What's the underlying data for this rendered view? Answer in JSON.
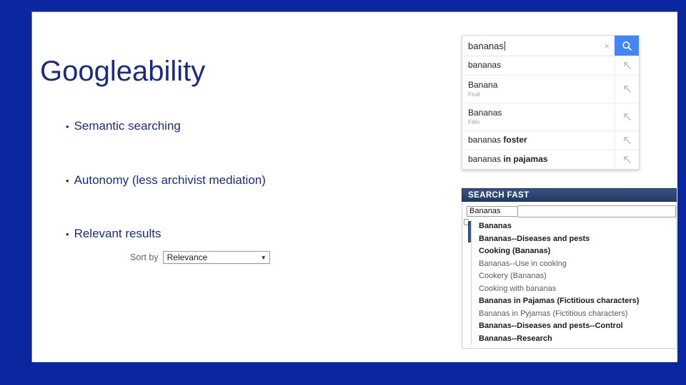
{
  "slide": {
    "title": "Googleability",
    "frame_color": "#0A27A0",
    "text_color": "#1B2C7E",
    "bullets": [
      {
        "marker": "•",
        "text": "Semantic searching"
      },
      {
        "marker": "•",
        "text": "Autonomy (less archivist mediation)"
      },
      {
        "marker": "•",
        "text": "Relevant results"
      }
    ]
  },
  "sort_control": {
    "label": "Sort by",
    "selected": "Relevance",
    "caret": "▼",
    "options": [
      "Relevance"
    ]
  },
  "google_autocomplete": {
    "query": "bananas",
    "clear_icon": "×",
    "search_icon": "search-icon",
    "accent_color": "#4285f4",
    "suggestions": [
      {
        "text": "bananas",
        "bold": "",
        "subtitle": ""
      },
      {
        "text": "Banana",
        "bold": "",
        "subtitle": "Fruit"
      },
      {
        "text": "Bananas",
        "bold": "",
        "subtitle": "Film"
      },
      {
        "text": "bananas ",
        "bold": "foster",
        "subtitle": ""
      },
      {
        "text": "bananas ",
        "bold": "in pajamas",
        "subtitle": ""
      }
    ]
  },
  "search_fast": {
    "header": "SEARCH FAST",
    "query": "Bananas",
    "suggestions": [
      {
        "text": "Bananas",
        "bold": true
      },
      {
        "text": "Bananas--Diseases and pests",
        "bold": true
      },
      {
        "text": "Cooking (Bananas)",
        "bold": true
      },
      {
        "text": "Bananas--Use in cooking",
        "bold": false
      },
      {
        "text": "Cookery (Bananas)",
        "bold": false
      },
      {
        "text": "Cooking with bananas",
        "bold": false
      },
      {
        "text": "Bananas in Pajamas (Fictitious characters)",
        "bold": true
      },
      {
        "text": "Bananas in Pyjamas (Fictitious characters)",
        "bold": false
      },
      {
        "text": "Bananas--Diseases and pests--Control",
        "bold": true
      },
      {
        "text": "Bananas--Research",
        "bold": true
      }
    ]
  }
}
